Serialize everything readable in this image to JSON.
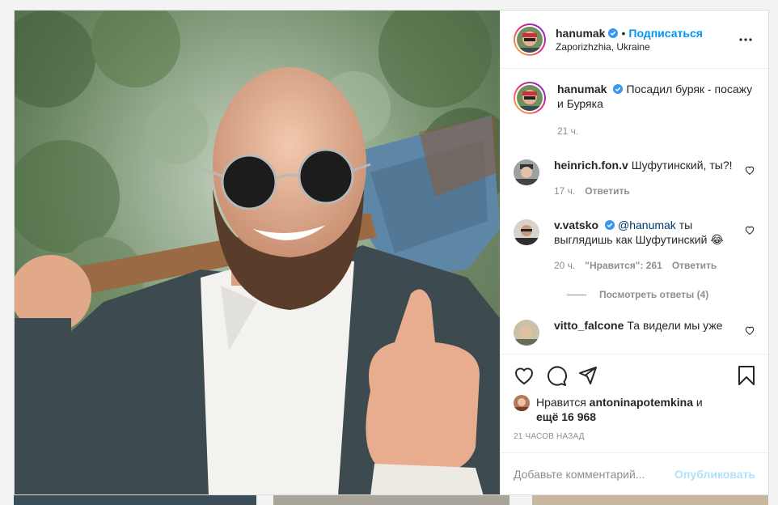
{
  "post": {
    "author": {
      "username": "hanumak",
      "verified": true,
      "follow_label": "Подписаться",
      "location": "Zaporizhzhia, Ukraine"
    },
    "caption": {
      "username": "hanumak",
      "text": "Посадил буряк - посажу и Буряка",
      "time": "21 ч."
    },
    "comments": [
      {
        "username": "heinrich.fon.v",
        "verified": false,
        "text": "Шуфутинский, ты?!",
        "time": "17 ч.",
        "reply_label": "Ответить"
      },
      {
        "username": "v.vatsko",
        "verified": true,
        "mention": "@hanumak",
        "text": "ты выглядишь как Шуфутинский",
        "emoji": "😂",
        "time": "20 ч.",
        "likes_label": "\"Нравится\": 261",
        "reply_label": "Ответить",
        "view_replies": "Посмотреть ответы (4)"
      },
      {
        "username": "vitto_falcone",
        "verified": false,
        "text": "Та видели мы уже"
      }
    ],
    "likes": {
      "prefix": "Нравится",
      "user": "antoninapotemkina",
      "connector": "и",
      "rest": "ещё 16 968"
    },
    "timestamp": "21 ЧАСОВ НАЗАД",
    "comment_box": {
      "placeholder": "Добавьте комментарий...",
      "publish_label": "Опубликовать"
    }
  },
  "colors": {
    "accent": "#0095f6",
    "verified": "#3897f0",
    "muted": "#8e8e8e",
    "publish_disabled": "#b2dffc"
  }
}
